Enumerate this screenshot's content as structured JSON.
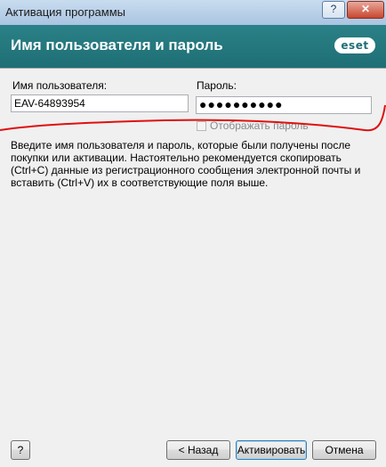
{
  "window": {
    "title": "Активация программы",
    "help_button": "?",
    "close_button": "✕"
  },
  "banner": {
    "heading": "Имя пользователя и пароль",
    "logo": "eset",
    "color": "#1e6f75"
  },
  "form": {
    "username_label": "Имя пользователя:",
    "username_value": "EAV-64893954",
    "password_label": "Пароль:",
    "password_value": "●●●●●●●●●●",
    "show_password_label": "Отображать пароль",
    "show_password_checked": false
  },
  "description": "Введите имя пользователя и пароль, которые были получены после покупки или активации. Настоятельно рекомендуется скопировать (Ctrl+C) данные из регистрационного сообщения электронной почты и вставить (Ctrl+V) их в соответствующие поля выше.",
  "buttons": {
    "help": "?",
    "back": "< Назад",
    "activate": "Активировать",
    "cancel": "Отмена"
  },
  "annotation_color": "#e01010"
}
